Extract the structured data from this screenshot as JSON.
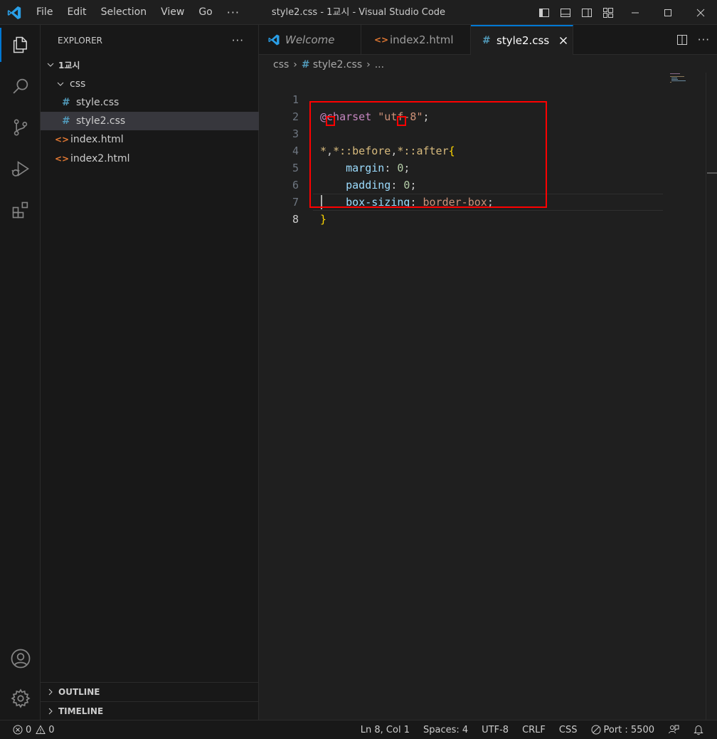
{
  "window": {
    "title": "style2.css - 1교시 - Visual Studio Code"
  },
  "menu": {
    "items": [
      "File",
      "Edit",
      "Selection",
      "View",
      "Go"
    ],
    "more": "···"
  },
  "sidebar": {
    "title": "EXPLORER",
    "more": "···",
    "folder": "1교시",
    "subfolder": "css",
    "files": [
      "style.css",
      "style2.css",
      "index.html",
      "index2.html"
    ],
    "outline": "OUTLINE",
    "timeline": "TIMELINE"
  },
  "tabs": [
    {
      "label": "Welcome"
    },
    {
      "label": "index2.html"
    },
    {
      "label": "style2.css"
    }
  ],
  "breadcrumb": {
    "folder": "css",
    "file": "style2.css",
    "symbol": "..."
  },
  "editor": {
    "line_numbers": [
      "1",
      "2",
      "3",
      "4",
      "5",
      "6",
      "7",
      "8"
    ],
    "tokens": {
      "charset_at": "@charset",
      "charset_str": "\"utf-8\"",
      "semi": ";",
      "sel_star1": "*",
      "comma": ",",
      "sel_before": "*::before",
      "sel_after": "*::after",
      "open_brace": "{",
      "prop_margin": "margin",
      "prop_padding": "padding",
      "prop_boxsizing": "box-sizing",
      "colon": ":",
      "zero": "0",
      "border_box": "border-box",
      "close_brace": "}"
    }
  },
  "status": {
    "errors": "0",
    "warnings": "0",
    "position": "Ln 8, Col 1",
    "spaces": "Spaces: 4",
    "encoding": "UTF-8",
    "eol": "CRLF",
    "language": "CSS",
    "port": "Port : 5500"
  },
  "colors": {
    "accent": "#0078d4",
    "annotation": "#ff0000"
  }
}
